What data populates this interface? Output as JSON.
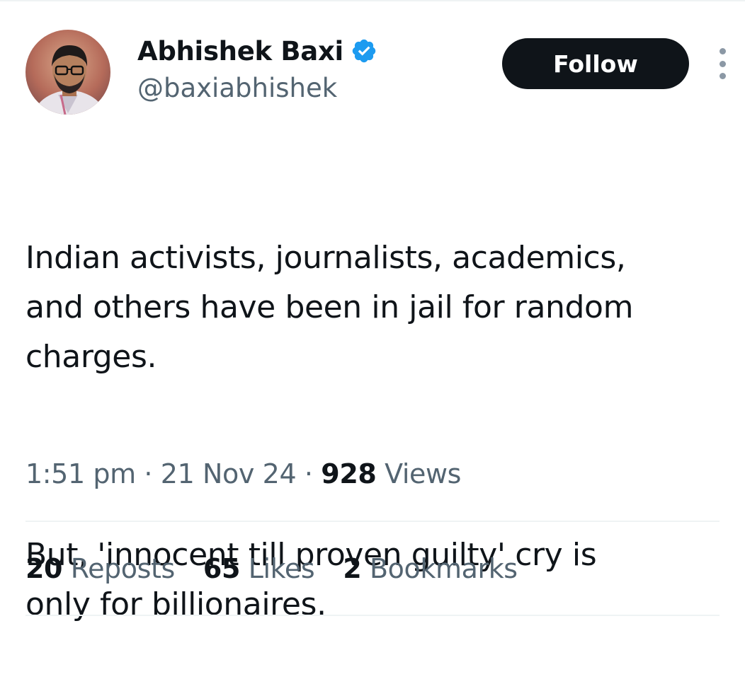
{
  "author": {
    "name": "Abhishek Baxi",
    "handle": "@baxiabhishek",
    "verified": true,
    "verified_color": "#1d9bf0"
  },
  "actions": {
    "follow_label": "Follow",
    "more_icon": "more-vertical-icon"
  },
  "tweet": {
    "paragraphs": [
      "Indian activists, journalists, academics,\nand others have been in jail for random\ncharges.",
      "But, 'innocent till proven guilty' cry is\nonly for billionaires."
    ]
  },
  "meta": {
    "time": "1:51 pm",
    "separator": " · ",
    "date": "21 Nov 24",
    "views_count": "928",
    "views_label": "Views"
  },
  "stats": {
    "reposts_count": "20",
    "reposts_label": "Reposts",
    "likes_count": "65",
    "likes_label": "Likes",
    "bookmarks_count": "2",
    "bookmarks_label": "Bookmarks"
  },
  "colors": {
    "text_primary": "#0f1419",
    "text_secondary": "#536471",
    "divider": "#eff3f4",
    "follow_bg": "#0f1419"
  }
}
